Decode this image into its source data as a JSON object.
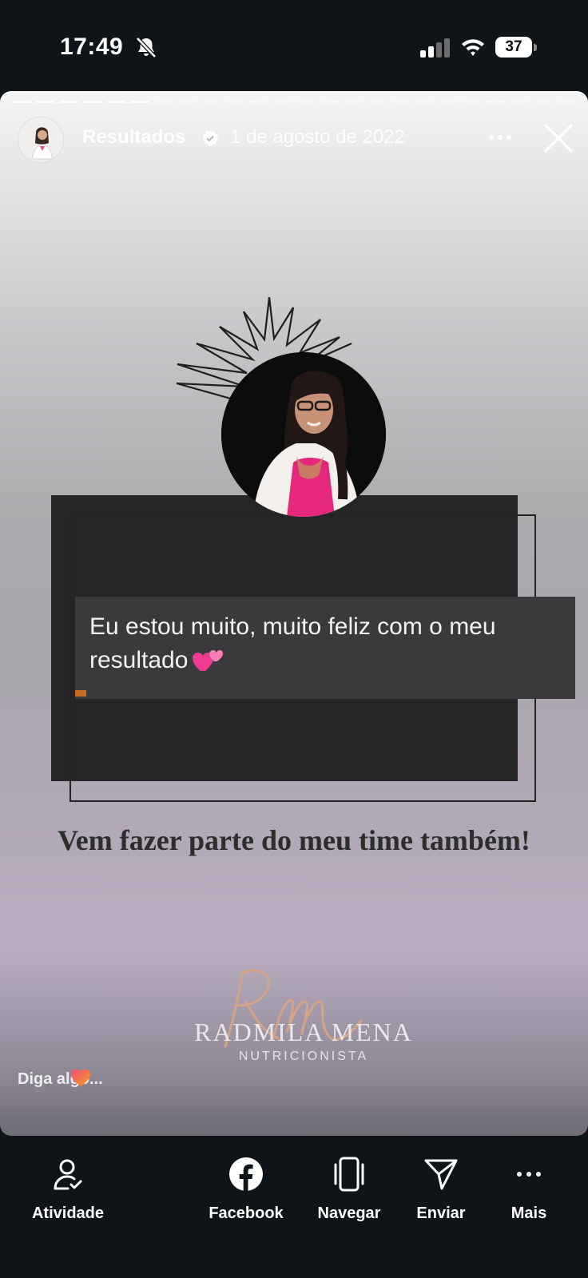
{
  "status_bar": {
    "time": "17:49",
    "battery_level": "37",
    "icons": [
      "bell-slash-icon",
      "cellular-signal-icon",
      "wifi-icon",
      "battery-icon"
    ]
  },
  "story": {
    "title": "Resultados",
    "date": "1 de agosto de 2022",
    "progress_segments": 24,
    "progress_viewed": 6,
    "quote": "Eu estou muito, muito feliz com o meu resultado",
    "tagline": "Vem fazer parte do meu time também!",
    "brand_name": "RADMILA MENA",
    "brand_subtitle": "NUTRICIONISTA",
    "reply_placeholder": "Diga algo...",
    "colors": {
      "accent": "#c96a1e",
      "dark_block": "#252426",
      "background": "#0f1419"
    }
  },
  "bottom_nav": [
    {
      "label": "Atividade",
      "icon": "activity-person-icon"
    },
    {
      "label": "Facebook",
      "icon": "facebook-icon"
    },
    {
      "label": "Navegar",
      "icon": "phone-navigate-icon"
    },
    {
      "label": "Enviar",
      "icon": "send-icon"
    },
    {
      "label": "Mais",
      "icon": "more-dots-icon"
    }
  ]
}
